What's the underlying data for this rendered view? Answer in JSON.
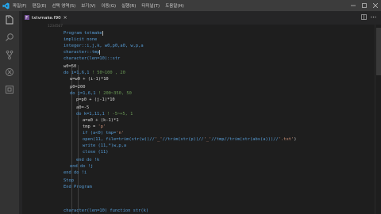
{
  "titlebar": {
    "menu": [
      "파일(F)",
      "편집(E)",
      "선택 영역(S)",
      "보기(V)",
      "이동(G)",
      "실행(R)",
      "터미널(T)",
      "도움말(H)"
    ]
  },
  "tab": {
    "icon": "fortran-file-icon",
    "label": "txtvmake.f90",
    "close": "×"
  },
  "breadcrumb": "1234567",
  "code": {
    "l1": "Program txtmake",
    "l2": "implicit none",
    "l3": "integer::i,j,k, w0,p0,a0, w,p,a",
    "l4": "character::tmp",
    "l5": "character(len=10)::str",
    "l6": "w0=50",
    "l7_a": "do i=1,6,1 ",
    "l7_c": "! 50~100 , 20",
    "l8": "w=w0 + (i-1)*10",
    "l9": "p0=200",
    "l10_a": "do j=1,6,1 ",
    "l10_c": "! 200~350, 50",
    "l11": "p=p0 + (j-1)*10",
    "l12": "a0=-5",
    "l13_a": "do k=1,11,1 ",
    "l13_c": "! -5~+5, 1",
    "l14": "a=a0 + (k-1)*1",
    "l15_a": "tmp = ",
    "l15_s": "'p'",
    "l16_a": "if (a<0) tmp=",
    "l16_s": "'n'",
    "l17_a": "open(11, file=trim(str(w))//",
    "l17_s1": "'_'",
    "l17_b": "//trim(str(p))//",
    "l17_s2": "'_'",
    "l17_c": "//tmp//trim(str(abs(a)))//",
    "l17_s3": "'.txt'",
    "l17_d": ")",
    "l18": "write (11,*)w,p,a",
    "l19": "close (11)",
    "l20": "end do !k",
    "l21": "end do !j",
    "l22": "end do !i",
    "l23": "Stop",
    "l24": "End Program",
    "l25": "",
    "l26": "character(len=10) function str(k)"
  },
  "colors": {
    "keyword": "#569cd6",
    "string": "#ce9178",
    "comment": "#6a9955",
    "text": "#d4d4d4",
    "background": "#1e1e1e"
  }
}
